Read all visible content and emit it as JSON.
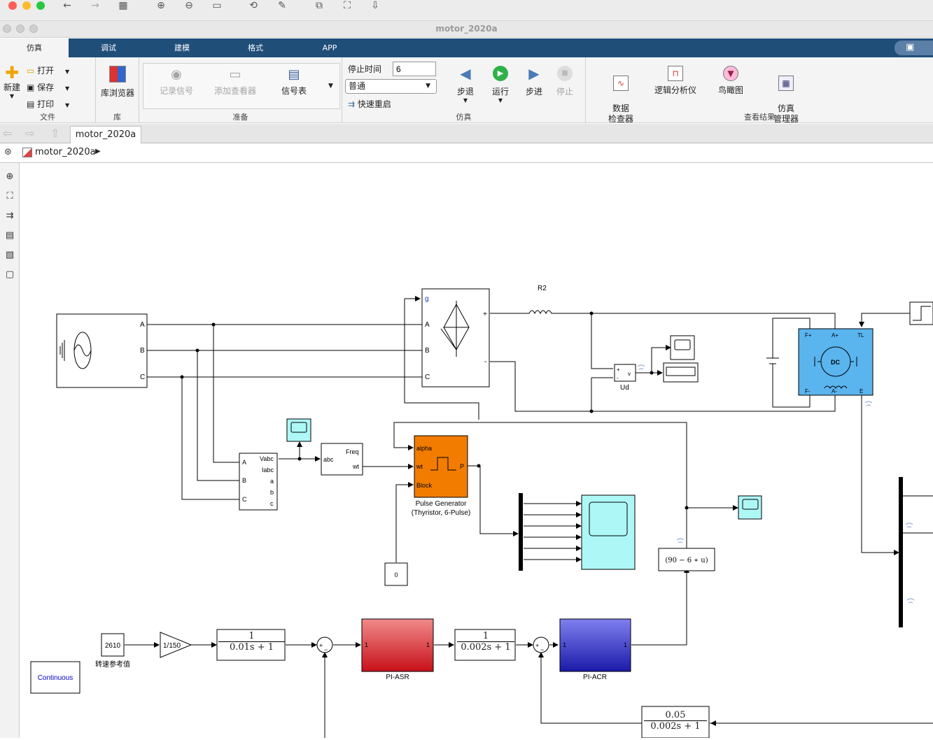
{
  "window": {
    "title": "motor_2020a"
  },
  "ribbon": {
    "tabs": [
      "仿真",
      "调试",
      "建模",
      "格式",
      "APP"
    ],
    "file": {
      "new": "新建",
      "open": "打开",
      "save": "保存",
      "print": "打印",
      "section": "文件"
    },
    "library": {
      "browser": "库浏览器",
      "section": "库"
    },
    "prepare": {
      "log_signals": "记录信号",
      "add_viewer": "添加查看器",
      "signal_table": "信号表",
      "section": "准备"
    },
    "simulate": {
      "stop_time_label": "停止时间",
      "stop_time_value": "6",
      "mode": "普通",
      "fast_restart": "快速重启",
      "step_back": "步退",
      "run": "运行",
      "step_forward": "步进",
      "stop": "停止",
      "section": "仿真"
    },
    "results": {
      "data_inspector": "数据\n检查器",
      "logic_analyzer": "逻辑分析仪",
      "birds_eye": "鸟瞰图",
      "sim_manager": "仿真\n管理器",
      "section": "查看结果"
    }
  },
  "editor": {
    "model_tab": "motor_2020a",
    "breadcrumb": "motor_2020a"
  },
  "diagram": {
    "source_ports": [
      "A",
      "B",
      "C"
    ],
    "bridge_ports": [
      "g",
      "A",
      "B",
      "C"
    ],
    "bridge_plus": "+",
    "bridge_minus": "-",
    "resistor_label": "R2",
    "dc_label": "DC",
    "ud_label": "Ud",
    "meas_ports_in": [
      "A",
      "B",
      "C"
    ],
    "meas_ports_out": [
      "Vabc",
      "Iabc",
      "a",
      "b",
      "c"
    ],
    "pll_in": "abc",
    "pll_out": [
      "Freq",
      "wt"
    ],
    "pulse_ports": [
      "alpha",
      "wt",
      "Block"
    ],
    "pulse_out": "P",
    "pulse_label_1": "Pulse Generator",
    "pulse_label_2": "(Thyristor, 6-Pulse)",
    "const_zero": "0",
    "fcn_expr": "(90 − 6 ∗ u)",
    "speed_ref_value": "2610",
    "speed_ref_label": "转速参考值",
    "gain_value": "1/150",
    "tf1": {
      "num": "1",
      "den": "0.01s + 1"
    },
    "tf2": {
      "num": "1",
      "den": "0.002s + 1"
    },
    "tf3": {
      "num": "0.05",
      "den": "0.002s + 1"
    },
    "asr_label": "PI-ASR",
    "acr_label": "PI-ACR",
    "subsys_port": "1",
    "powergui": "Continuous",
    "motor_ports": [
      "F+",
      "A+",
      "TL",
      "F-",
      "A-",
      "E"
    ],
    "volt_ports": [
      "+",
      "-",
      "v"
    ]
  },
  "colors": {
    "ribbon_tab_bg": "#1f4e79",
    "pulse_block": "#f27c00",
    "asr_block": "#d9282e",
    "acr_block": "#3030c0",
    "motor_block": "#5ab4ee",
    "scope_block": "#aef7f7"
  }
}
